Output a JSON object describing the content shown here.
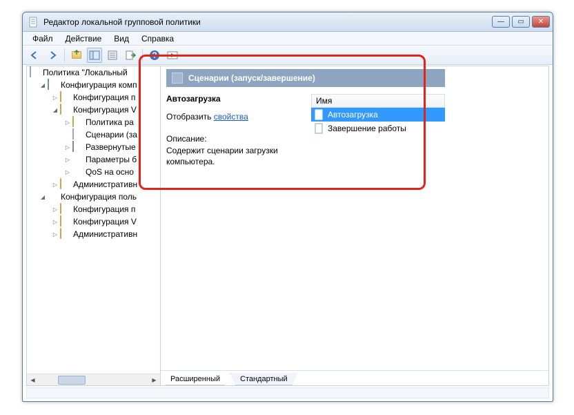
{
  "window": {
    "title": "Редактор локальной групповой политики"
  },
  "menu": {
    "file": "Файл",
    "action": "Действие",
    "view": "Вид",
    "help": "Справка"
  },
  "tree": {
    "root": "Политика \"Локальный",
    "compConfig": "Конфигурация комп",
    "softwareSettings": "Конфигурация п",
    "windowsSettings": "Конфигурация V",
    "policyRa": "Политика ра",
    "scenarios": "Сценарии (за",
    "deployed": "Развернутые",
    "paramsB": "Параметры б",
    "qos": "QoS на осно",
    "adminTpl1": "Административн",
    "userConfig": "Конфигурация поль",
    "softwareSettings2": "Конфигурация п",
    "windowsSettings2": "Конфигурация V",
    "adminTpl2": "Административн"
  },
  "panel": {
    "headerTitle": "Сценарии (запуск/завершение)",
    "detailsTitle": "Автозагрузка",
    "showWord": "Отобразить",
    "propsLink": "свойства",
    "descLabel": "Описание:",
    "descText": "Содержит сценарии загрузки компьютера."
  },
  "list": {
    "columnName": "Имя",
    "items": [
      {
        "label": "Автозагрузка",
        "selected": true
      },
      {
        "label": "Завершение работы",
        "selected": false
      }
    ]
  },
  "tabs": {
    "extended": "Расширенный",
    "standard": "Стандартный"
  }
}
